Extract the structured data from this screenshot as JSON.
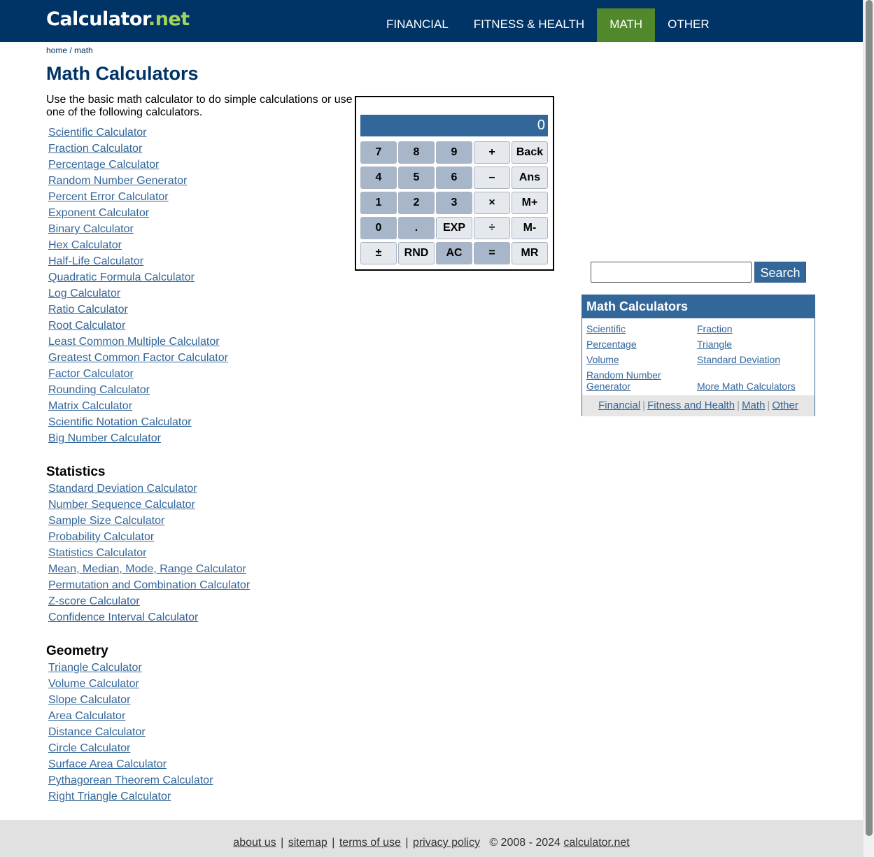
{
  "header": {
    "logo_main": "Calculator",
    "logo_dot": ".",
    "logo_tld": "net",
    "nav": [
      {
        "label": "FINANCIAL",
        "active": false
      },
      {
        "label": "FITNESS & HEALTH",
        "active": false
      },
      {
        "label": "MATH",
        "active": true
      },
      {
        "label": "OTHER",
        "active": false
      }
    ]
  },
  "breadcrumb": {
    "home": "home",
    "sep": " / ",
    "current": "math"
  },
  "page_title": "Math Calculators",
  "intro": "Use the basic math calculator to do simple calculations or use one of the following calculators.",
  "math_links": [
    "Scientific Calculator",
    "Fraction Calculator",
    "Percentage Calculator",
    "Random Number Generator",
    "Percent Error Calculator",
    "Exponent Calculator",
    "Binary Calculator",
    "Hex Calculator",
    "Half-Life Calculator",
    "Quadratic Formula Calculator",
    "Log Calculator",
    "Ratio Calculator",
    "Root Calculator",
    "Least Common Multiple Calculator",
    "Greatest Common Factor Calculator",
    "Factor Calculator",
    "Rounding Calculator",
    "Matrix Calculator",
    "Scientific Notation Calculator",
    "Big Number Calculator"
  ],
  "statistics": {
    "heading": "Statistics",
    "links": [
      "Standard Deviation Calculator",
      "Number Sequence Calculator",
      "Sample Size Calculator",
      "Probability Calculator",
      "Statistics Calculator",
      "Mean, Median, Mode, Range Calculator",
      "Permutation and Combination Calculator",
      "Z-score Calculator",
      "Confidence Interval Calculator"
    ]
  },
  "geometry": {
    "heading": "Geometry",
    "links": [
      "Triangle Calculator",
      "Volume Calculator",
      "Slope Calculator",
      "Area Calculator",
      "Distance Calculator",
      "Circle Calculator",
      "Surface Area Calculator",
      "Pythagorean Theorem Calculator",
      "Right Triangle Calculator"
    ]
  },
  "calculator": {
    "display": "0",
    "keys": [
      {
        "label": "7",
        "style": "num"
      },
      {
        "label": "8",
        "style": "num"
      },
      {
        "label": "9",
        "style": "num"
      },
      {
        "label": "+",
        "style": "op"
      },
      {
        "label": "Back",
        "style": "op"
      },
      {
        "label": "4",
        "style": "num"
      },
      {
        "label": "5",
        "style": "num"
      },
      {
        "label": "6",
        "style": "num"
      },
      {
        "label": "–",
        "style": "op"
      },
      {
        "label": "Ans",
        "style": "op"
      },
      {
        "label": "1",
        "style": "num"
      },
      {
        "label": "2",
        "style": "num"
      },
      {
        "label": "3",
        "style": "num"
      },
      {
        "label": "×",
        "style": "op"
      },
      {
        "label": "M+",
        "style": "op"
      },
      {
        "label": "0",
        "style": "num"
      },
      {
        "label": ".",
        "style": "num"
      },
      {
        "label": "EXP",
        "style": "op"
      },
      {
        "label": "÷",
        "style": "op"
      },
      {
        "label": "M-",
        "style": "op"
      },
      {
        "label": "±",
        "style": "op"
      },
      {
        "label": "RND",
        "style": "op"
      },
      {
        "label": "AC",
        "style": "num"
      },
      {
        "label": "=",
        "style": "num"
      },
      {
        "label": "MR",
        "style": "op"
      }
    ]
  },
  "search": {
    "value": "",
    "button": "Search"
  },
  "sidebox": {
    "heading": "Math Calculators",
    "links": {
      "scientific": "Scientific",
      "fraction": "Fraction",
      "percentage": "Percentage",
      "triangle": "Triangle",
      "volume": "Volume",
      "std_dev": "Standard Deviation",
      "random_1": "Random Number",
      "random_2": "Generator",
      "more": "More Math Calculators"
    },
    "footer_links": [
      "Financial",
      "Fitness and Health",
      "Math",
      "Other"
    ],
    "footer_sep": "|"
  },
  "footer": {
    "links": [
      "about us",
      "sitemap",
      "terms of use",
      "privacy policy"
    ],
    "sep": "|",
    "copyright": "© 2008 - 2024",
    "site": "calculator.net"
  },
  "colors": {
    "header_bg": "#003366",
    "nav_active": "#51882c",
    "logo_accent": "#a2d65a",
    "link": "#336699",
    "accent_blue": "#336699",
    "key_num": "#a7b6c8",
    "key_op": "#e5e9ee",
    "footer_bg": "#e1e1e1"
  }
}
